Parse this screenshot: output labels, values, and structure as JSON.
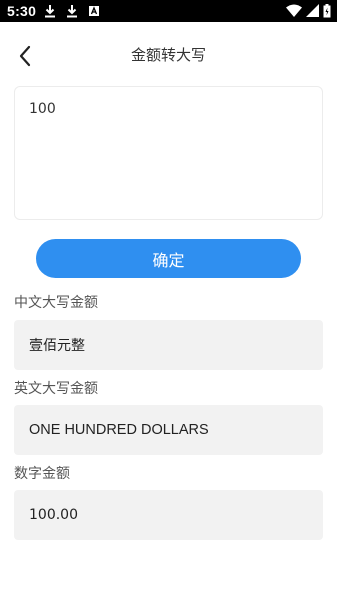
{
  "status_bar": {
    "time": "5:30",
    "left_icons": [
      "download-icon",
      "download-icon",
      "app-notification-icon"
    ],
    "right_icons": [
      "wifi-icon",
      "signal-icon",
      "battery-icon"
    ]
  },
  "header": {
    "title": "金额转大写",
    "back_icon": "chevron-left-icon"
  },
  "input": {
    "value": "100"
  },
  "confirm_button": {
    "label": "确定",
    "color": "#2f8ff0"
  },
  "results": {
    "chinese": {
      "label": "中文大写金额",
      "value": "壹佰元整"
    },
    "english": {
      "label": "英文大写金额",
      "value": "ONE HUNDRED DOLLARS"
    },
    "numeric": {
      "label": "数字金额",
      "value": "100.00"
    }
  }
}
